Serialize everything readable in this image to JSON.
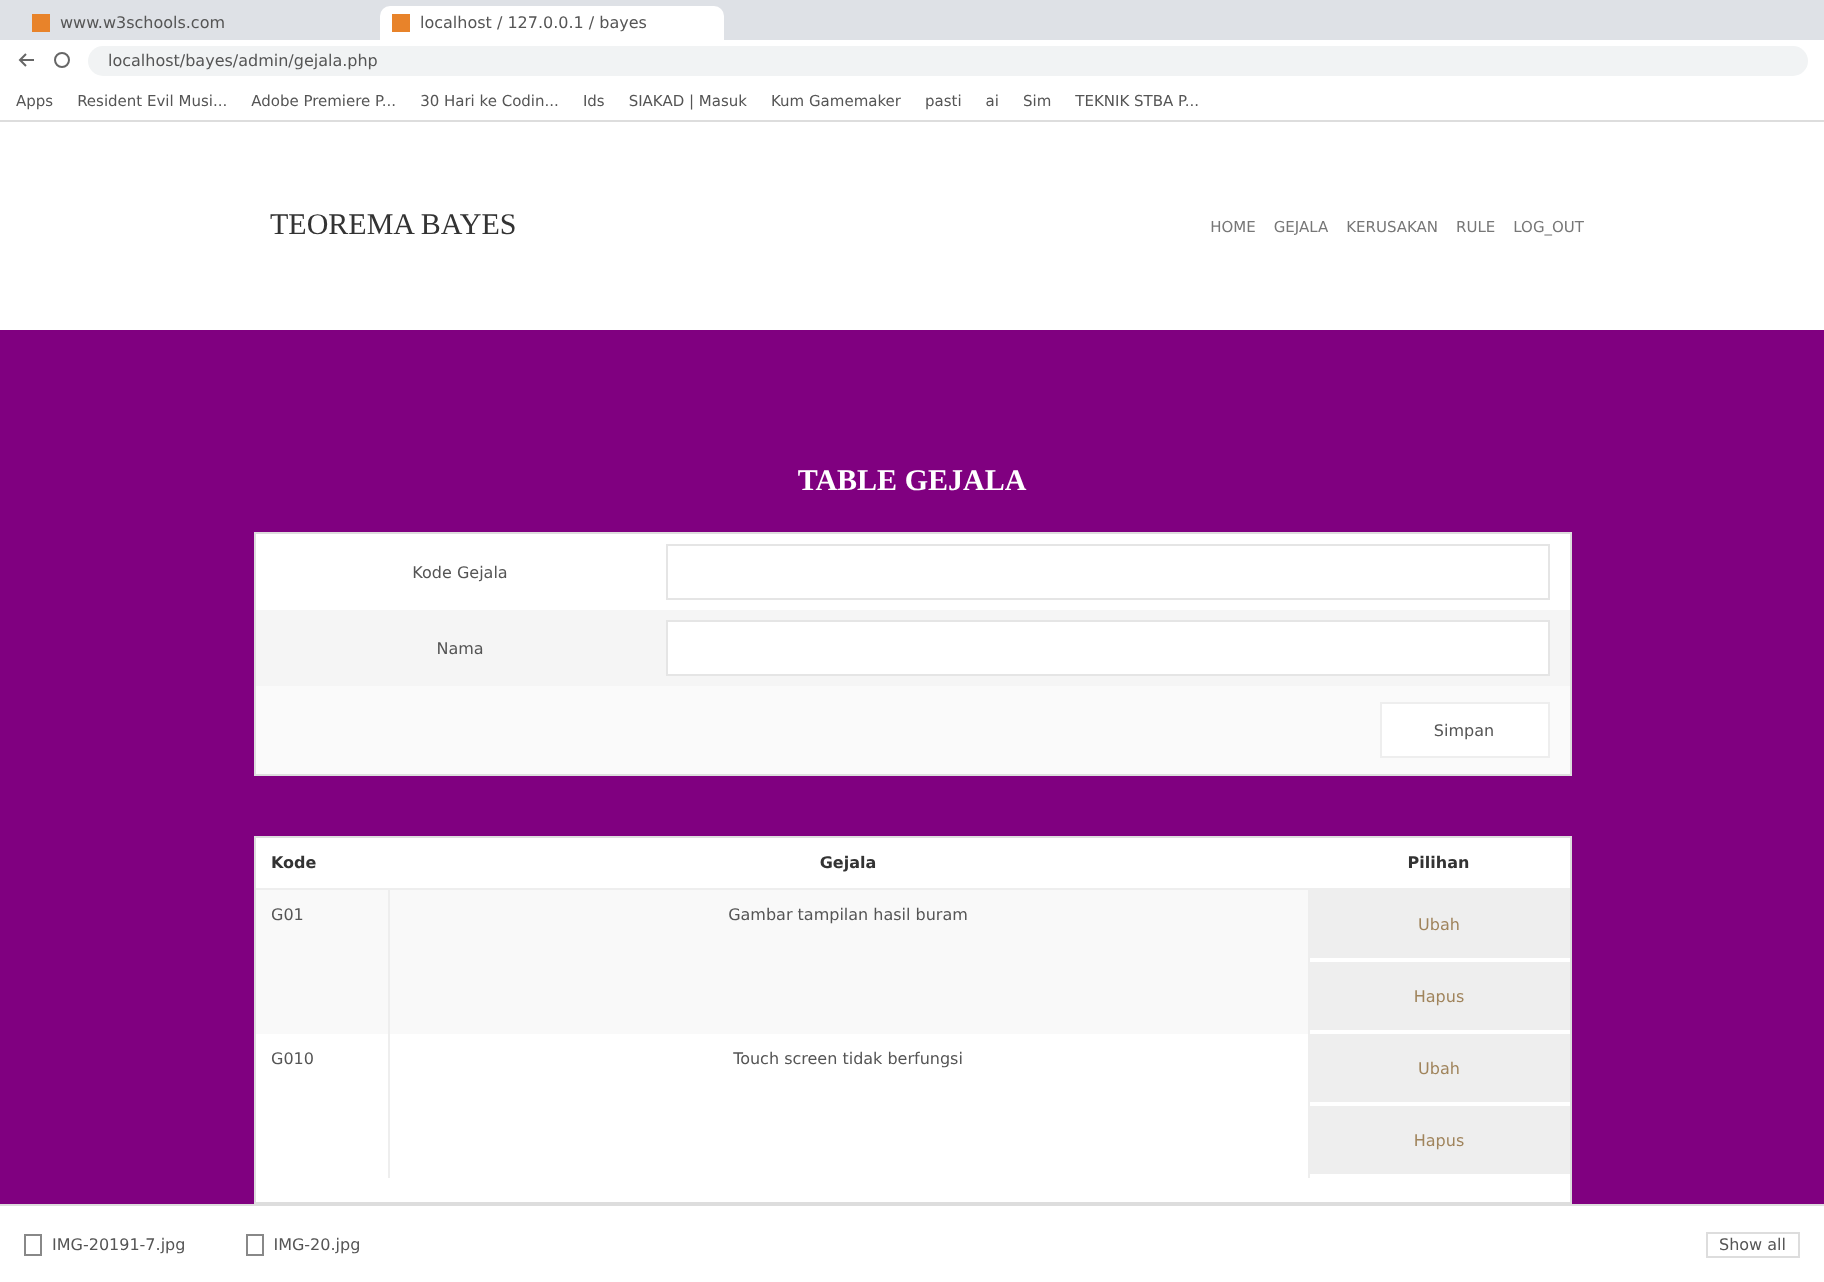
{
  "browser": {
    "tabs": [
      {
        "title": "www.w3schools.com",
        "selected": false
      },
      {
        "title": "localhost / 127.0.0.1 / bayes",
        "selected": true
      }
    ],
    "url": "localhost/bayes/admin/gejala.php",
    "bookmarks": [
      "Apps",
      "Resident Evil Musi...",
      "Adobe Premiere P...",
      "30 Hari ke Codin...",
      "Ids",
      "SIAKAD | Masuk",
      "Kum Gamemaker",
      "pasti",
      "ai",
      "Sim",
      "TEKNIK STBA P..."
    ]
  },
  "site": {
    "brand": "TEOREMA BAYES",
    "nav": [
      "HOME",
      "GEJALA",
      "KERUSAKAN",
      "RULE",
      "LOG_OUT"
    ]
  },
  "page_title": "TABLE GEJALA",
  "form": {
    "fields": [
      {
        "label": "Kode Gejala"
      },
      {
        "label": "Nama"
      }
    ],
    "submit": "Simpan"
  },
  "table": {
    "columns": [
      "Kode",
      "Gejala",
      "Pilihan"
    ],
    "rows": [
      {
        "code": "G01",
        "symptom": "Gambar tampilan hasil buram",
        "actions": [
          "Ubah",
          "Hapus"
        ]
      },
      {
        "code": "G010",
        "symptom": "Touch screen tidak berfungsi",
        "actions": [
          "Ubah",
          "Hapus"
        ]
      }
    ]
  },
  "downloads": {
    "items": [
      "IMG-20191-7.jpg",
      "IMG-20.jpg"
    ],
    "show_all": "Show all"
  }
}
